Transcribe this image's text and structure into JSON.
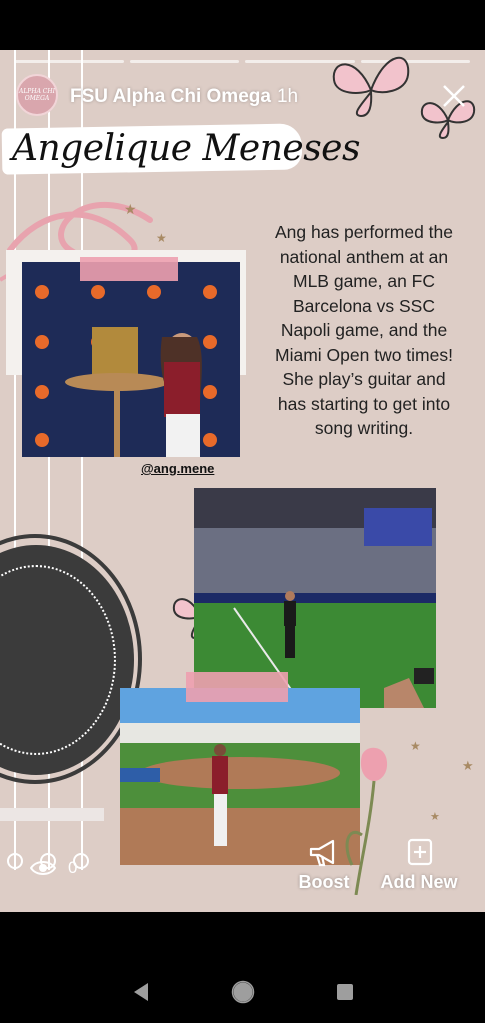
{
  "header": {
    "avatar_text": "ALPHA CHI OMEGA",
    "account_name": "FSU Alpha Chi Omega",
    "time_ago": "1h"
  },
  "story": {
    "title": "Angelique Meneses",
    "description": "Ang has performed the national anthem at an MLB game, an FC Barcelona vs SSC Napoli game, and the Miami Open two times! She play’s guitar and has starting to get into song writing.",
    "handle": "@ang.mene",
    "progress_segments": 4
  },
  "footer": {
    "view_count": "0",
    "boost_label": "Boost",
    "add_new_label": "Add New"
  },
  "icons": {
    "close": "close-icon",
    "eye": "eye-icon",
    "boost": "megaphone-icon",
    "add_new": "add-square-icon",
    "nav_back": "back-triangle-icon",
    "nav_home": "home-circle-icon",
    "nav_recents": "recents-square-icon"
  },
  "colors": {
    "background": "#ddcdc6",
    "accent_pink": "#eda0af",
    "guitar_body": "#3b3b3b"
  }
}
